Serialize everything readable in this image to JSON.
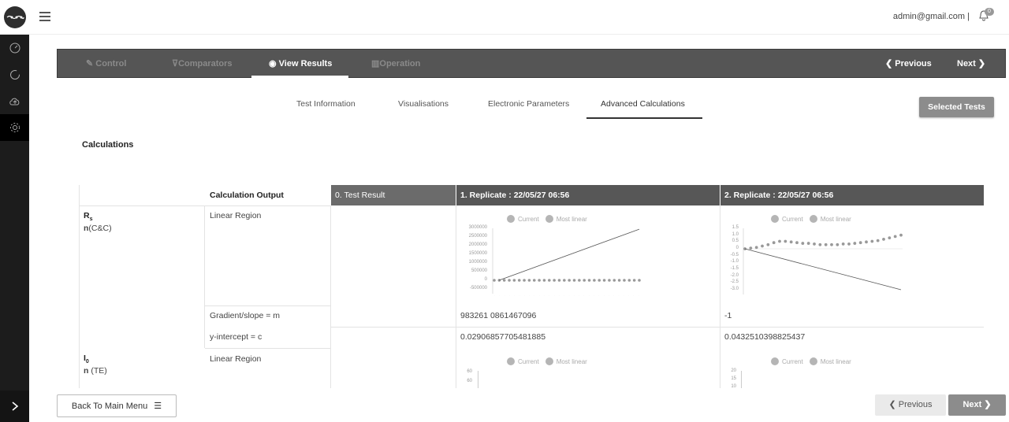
{
  "header": {
    "user_email": "admin@gmail.com |",
    "notification_count": "0"
  },
  "steps": [
    {
      "label": "Control",
      "icon": "pin-icon"
    },
    {
      "label": "Comparators",
      "icon": "cart-icon"
    },
    {
      "label": "View Results",
      "icon": "eye-icon"
    },
    {
      "label": "Operation",
      "icon": "chart-icon"
    }
  ],
  "step_nav": {
    "previous": "Previous",
    "next": "Next"
  },
  "subtabs": [
    "Test Information",
    "Visualisations",
    "Electronic Parameters",
    "Advanced Calculations"
  ],
  "selected_tests_label": "Selected Tests",
  "section_title": "Calculations",
  "table": {
    "headers": {
      "output": "Calculation Output",
      "col0": "0. Test Result",
      "col1": "1. Replicate : 22/05/27 06:56",
      "col2": "2. Replicate : 22/05/27 06:56"
    },
    "rows": {
      "rs_symbol": "R",
      "rs_sub": "s",
      "rs_n": "n",
      "rs_n_suffix": "(C&C)",
      "linear_region": "Linear Region",
      "gradient_label": "Gradient/slope = m",
      "gradient_val1": "983261 0861467096",
      "gradient_val2": "-1",
      "intercept_label": "y-intercept = c",
      "intercept_val1": "0.02906857705481885",
      "intercept_val2": "0.0432510398825437",
      "io_symbol": "I",
      "io_sub": "0",
      "io_n": "n",
      "io_n_suffix": "(TE)",
      "linear_region2": "Linear Region"
    },
    "legend": {
      "current": "Current",
      "most_linear": "Most linear"
    },
    "chart1_yticks": [
      "3000000",
      "2500000",
      "2000000",
      "1500000",
      "1000000",
      "500000",
      "0",
      "-500000"
    ],
    "chart2_yticks": [
      "1.5",
      "1.0",
      "0.5",
      "0",
      "-0.5",
      "-1.0",
      "-1.5",
      "-2.0",
      "-2.5",
      "-3.0"
    ],
    "chart3_yticks": [
      "60",
      "60"
    ],
    "chart4_yticks": [
      "20",
      "15",
      "10"
    ]
  },
  "chart_data": [
    {
      "type": "scatter",
      "title": "",
      "series": [
        {
          "name": "Current",
          "values": [
            0,
            0,
            0,
            0,
            0,
            0,
            0,
            0,
            0,
            0,
            0,
            0,
            0,
            0,
            0,
            0,
            0,
            0,
            0,
            0,
            0,
            0,
            0,
            0,
            0,
            0,
            0,
            0,
            0,
            0
          ]
        },
        {
          "name": "Most linear",
          "values": [
            0,
            2950000
          ]
        }
      ],
      "ylim": [
        -500000,
        3000000
      ]
    },
    {
      "type": "scatter",
      "title": "",
      "series": [
        {
          "name": "Current",
          "values": [
            0,
            0.05,
            0.1,
            0.2,
            0.3,
            0.45,
            0.55,
            0.55,
            0.5,
            0.45,
            0.4,
            0.4,
            0.35,
            0.3,
            0.3,
            0.3,
            0.3,
            0.35,
            0.35,
            0.4,
            0.45,
            0.5,
            0.55,
            0.6,
            0.7,
            0.8,
            0.9,
            1.0
          ]
        },
        {
          "name": "Most linear",
          "values": [
            0,
            -3.0
          ]
        }
      ],
      "ylim": [
        -3.0,
        1.5
      ]
    }
  ],
  "bottom": {
    "back": "Back To Main Menu",
    "previous": "Previous",
    "next": "Next"
  }
}
